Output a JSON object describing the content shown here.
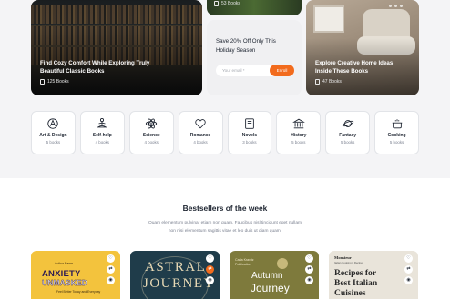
{
  "hero": {
    "library_card": {
      "title": "Find Cozy Comfort While Exploring Truly Beautiful Classic Books",
      "count": "125 Books"
    },
    "top_card": {
      "count": "53 Books"
    },
    "promo": {
      "title": "Save 20% Off Only This Holiday Season",
      "email_placeholder": "Your email *",
      "button": "Enroll"
    },
    "room_card": {
      "title": "Explore Creative Home Ideas Inside These Books",
      "count": "47 Books"
    }
  },
  "categories": [
    {
      "name": "Art & Design",
      "count": "5 books",
      "icon": "palette-icon"
    },
    {
      "name": "Self-help",
      "count": "4 books",
      "icon": "meditation-icon"
    },
    {
      "name": "Science",
      "count": "4 books",
      "icon": "atom-icon"
    },
    {
      "name": "Romance",
      "count": "4 books",
      "icon": "heart-icon"
    },
    {
      "name": "Novels",
      "count": "3 books",
      "icon": "book-icon"
    },
    {
      "name": "History",
      "count": "5 books",
      "icon": "landmark-icon"
    },
    {
      "name": "Fantasy",
      "count": "5 books",
      "icon": "planet-icon"
    },
    {
      "name": "Cooking",
      "count": "5 books",
      "icon": "cooking-pot-icon"
    }
  ],
  "bestsellers": {
    "title": "Bestsellers of the week",
    "description": "Quam elementum pulvinar etiam non quam. Faucibus nisl tincidunt eget nullam non nisi elementum sagittis vitae et leo duis ut diam quam.",
    "books": [
      {
        "cover_title_1": "ANXIETY",
        "cover_title_2": "UNMASKED",
        "cover_top": "Author Name",
        "cover_sub": "Feel Better Today and Everyday"
      },
      {
        "cover_title_1": "ASTRAL",
        "cover_title_2": "JOURNEY"
      },
      {
        "cover_top": "Carla Kravitz\nPublication",
        "cover_title_1": "Autumn",
        "cover_title_2": "Journey"
      },
      {
        "cover_brand": "Monsieur",
        "cover_sub": "Italian Cooking & Recipes",
        "cover_title": "Recipes for Best Italian Cuisines"
      }
    ]
  },
  "colors": {
    "accent": "#f26b1d",
    "text": "#1d2430",
    "muted": "#7b8190"
  }
}
